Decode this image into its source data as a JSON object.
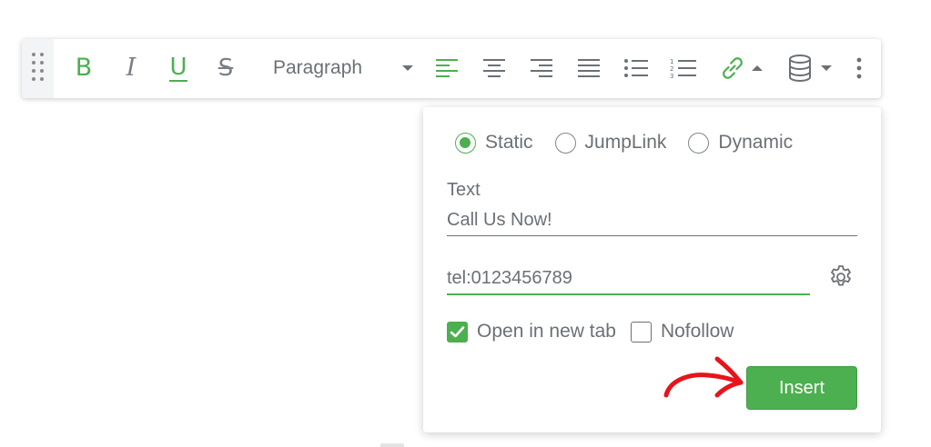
{
  "toolbar": {
    "bold_label": "B",
    "italic_label": "I",
    "underline_label": "U",
    "strike_label": "S",
    "block_format": "Paragraph"
  },
  "link_popup": {
    "link_types": [
      {
        "label": "Static",
        "checked": true
      },
      {
        "label": "JumpLink",
        "checked": false
      },
      {
        "label": "Dynamic",
        "checked": false
      }
    ],
    "text_label": "Text",
    "text_value": "Call Us Now!",
    "url_value": "tel:0123456789",
    "open_new_tab_label": "Open in new tab",
    "open_new_tab_checked": true,
    "nofollow_label": "Nofollow",
    "nofollow_checked": false,
    "insert_label": "Insert"
  },
  "colors": {
    "accent": "#4caf50",
    "text": "#6b7075",
    "annotation_arrow": "#e8141b"
  }
}
